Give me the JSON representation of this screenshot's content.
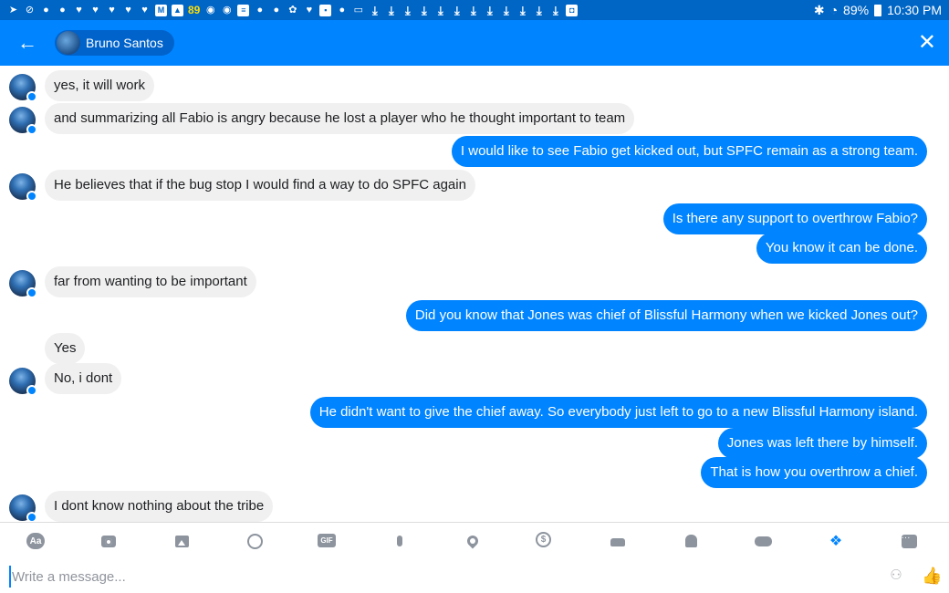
{
  "status_bar": {
    "notification_count": "89",
    "battery": "89%",
    "time": "10:30 PM"
  },
  "header": {
    "contact_name": "Bruno Santos"
  },
  "conversation": {
    "messages": [
      {
        "text": "yes, it will work"
      },
      {
        "text": "and summarizing all Fabio is angry because he lost a player who he thought important to team"
      },
      {
        "text": "I would like to see Fabio get kicked out, but SPFC remain as a strong team."
      },
      {
        "text": "He believes that if the bug stop I would find a way to do SPFC again"
      },
      {
        "text": "Is there any support to overthrow Fabio?"
      },
      {
        "text": "You know it can be done."
      },
      {
        "text": "far from wanting to be important"
      },
      {
        "text": "Did you know that Jones was chief of Blissful Harmony when we kicked Jones out?"
      },
      {
        "text": "Yes"
      },
      {
        "text": "No, i dont"
      },
      {
        "text": "He didn't want to give the chief away. So everybody just left to go to a new Blissful Harmony island."
      },
      {
        "text": "Jones was left there by himself."
      },
      {
        "text": "That is how you overthrow a chief."
      },
      {
        "text": "I dont know nothing about the tribe"
      }
    ]
  },
  "toolbar": {
    "text_label": "Aa",
    "gif_label": "GIF",
    "payment_label": "$",
    "icons": [
      "text-format-icon",
      "camera-icon",
      "image-icon",
      "emoji-icon",
      "gif-icon",
      "microphone-icon",
      "location-icon",
      "payment-icon",
      "ride-icon",
      "reminder-icon",
      "games-icon",
      "dropbox-icon",
      "more-icon"
    ]
  },
  "composer": {
    "placeholder": "Write a message..."
  },
  "colors": {
    "status_bar": "#0066c6",
    "header": "#0084ff",
    "outgoing_bubble": "#0084ff",
    "incoming_bubble": "#f1f0f0"
  }
}
